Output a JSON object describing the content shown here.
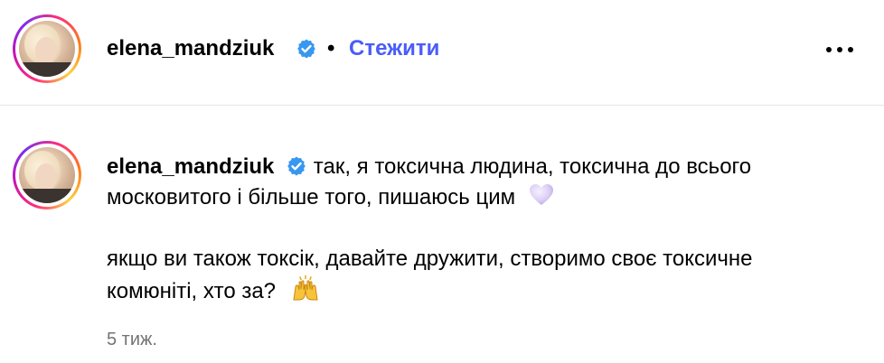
{
  "header": {
    "username": "elena_mandziuk",
    "separator": "•",
    "follow_label": "Стежити",
    "more_icon": "more-horizontal-icon"
  },
  "comment": {
    "username": "elena_mandziuk",
    "lines": [
      "так, я токсична людина, токсична до всього",
      "московитого і більше того, пишаюсь цим",
      "якщо ви також токсік, давайте дружити, створимо своє токсичне",
      "комюніті, хто за?"
    ],
    "emoji_1": "light-purple-heart-emoji",
    "emoji_2": "raising-hands-emoji",
    "timestamp": "5 тиж."
  },
  "colors": {
    "link": "#4a5df9",
    "verified": "#3897f0",
    "muted": "#737373",
    "divider": "#e6e6e6"
  }
}
